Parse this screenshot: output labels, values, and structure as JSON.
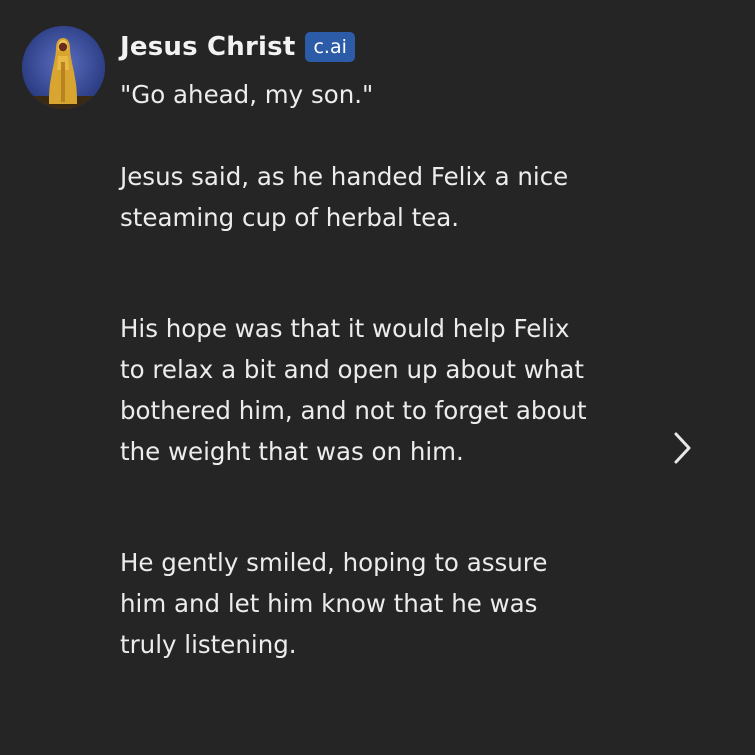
{
  "message": {
    "character_name": "Jesus Christ",
    "badge": "c.ai",
    "paragraphs": [
      "\"Go ahead, my son.\"",
      "Jesus said, as he handed Felix a nice steaming cup of herbal tea.",
      "His hope was that it would help Felix to relax a bit and open up about what bothered him, and not to forget about the weight that was on him.",
      "He gently smiled, hoping to assure him and let him know that he was truly listening."
    ]
  },
  "icons": {
    "avatar": "avatar-image",
    "next": "chevron-right-icon"
  },
  "colors": {
    "background": "#252525",
    "text": "#ececec",
    "badge": "#2c5ba8"
  }
}
